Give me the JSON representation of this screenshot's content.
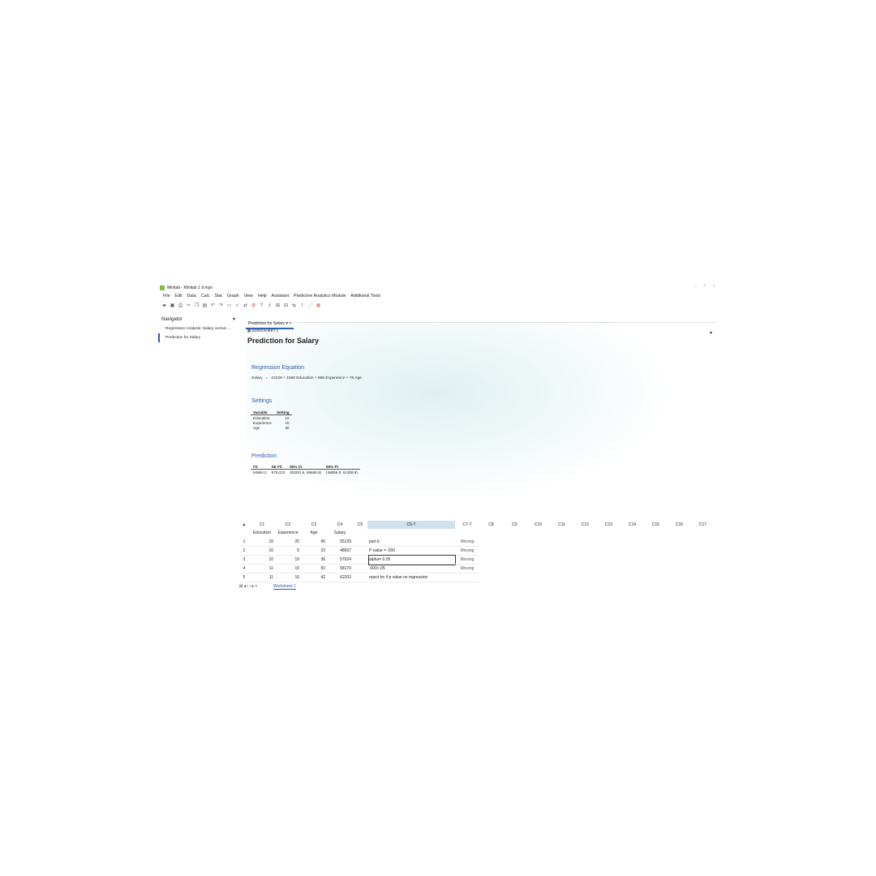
{
  "window": {
    "title": "Minitab - Minitab 1 9.mpx",
    "controls": "- ♂ ›"
  },
  "menu": [
    "File",
    "Edit",
    "Data",
    "Calc",
    "Stat",
    "Graph",
    "View",
    "Help",
    "Assistant",
    "Predictive Analytics Module",
    "Additional Tools"
  ],
  "navigator": {
    "title": "Navigator",
    "items": [
      "Regression Analysis: Salary versus ...",
      "Prediction for Salary"
    ]
  },
  "output": {
    "tab": "Prediction for Salary",
    "tab_controls": "▾ ×",
    "worksheet_label": "WORKSHEET 1",
    "title": "Prediction for Salary",
    "regression": {
      "heading": "Regression Equation",
      "lhs": "Salary",
      "eq_sign": "=",
      "rhs": "22229 + 1960 Education + 696 Experience + 76 Age"
    },
    "settings": {
      "heading": "Settings",
      "columns": [
        "Variable",
        "Setting"
      ],
      "rows": [
        [
          "Education",
          "12"
        ],
        [
          "Experience",
          "10"
        ],
        [
          "Age",
          "30"
        ]
      ]
    },
    "prediction": {
      "heading": "Prediction",
      "columns": [
        "Fit",
        "SE Fit",
        "90% CI",
        "90% PI"
      ],
      "row": [
        "54984.2",
        "975.013",
        "(53281.9, 56686.5)",
        "(48658.5, 61309.9)"
      ]
    }
  },
  "worksheet": {
    "corner": "▲",
    "col_ids": [
      "C1",
      "C2",
      "C3",
      "C4",
      "C5",
      "C6-T",
      "C7-T",
      "C8",
      "C9",
      "C10",
      "C11",
      "C12",
      "C13",
      "C14",
      "C15",
      "C16",
      "C17"
    ],
    "col_names": [
      "Education",
      "Experience",
      "Age",
      "Salary",
      "",
      "",
      "",
      "",
      "",
      "",
      "",
      "",
      "",
      "",
      "",
      "",
      ""
    ],
    "rows": [
      [
        "1",
        "10",
        "20",
        "45",
        "55139",
        "",
        "part b",
        "Missing"
      ],
      [
        "2",
        "10",
        "5",
        "23",
        "48937",
        "",
        "P value = .000",
        "Missing"
      ],
      [
        "3",
        "10",
        "19",
        "36",
        "57624",
        "",
        "alpha= 0.05",
        "Missing"
      ],
      [
        "4",
        "11",
        "15",
        "50",
        "58170",
        "",
        ".000<.05",
        "Missing"
      ],
      [
        "5",
        "11",
        "16",
        "42",
        "62202",
        "",
        "reject ho if p value on regression",
        ""
      ]
    ],
    "sheet_tab": "Worksheet 1",
    "sheet_nav": "⊞ ◂ ‹ › ▸ +"
  }
}
